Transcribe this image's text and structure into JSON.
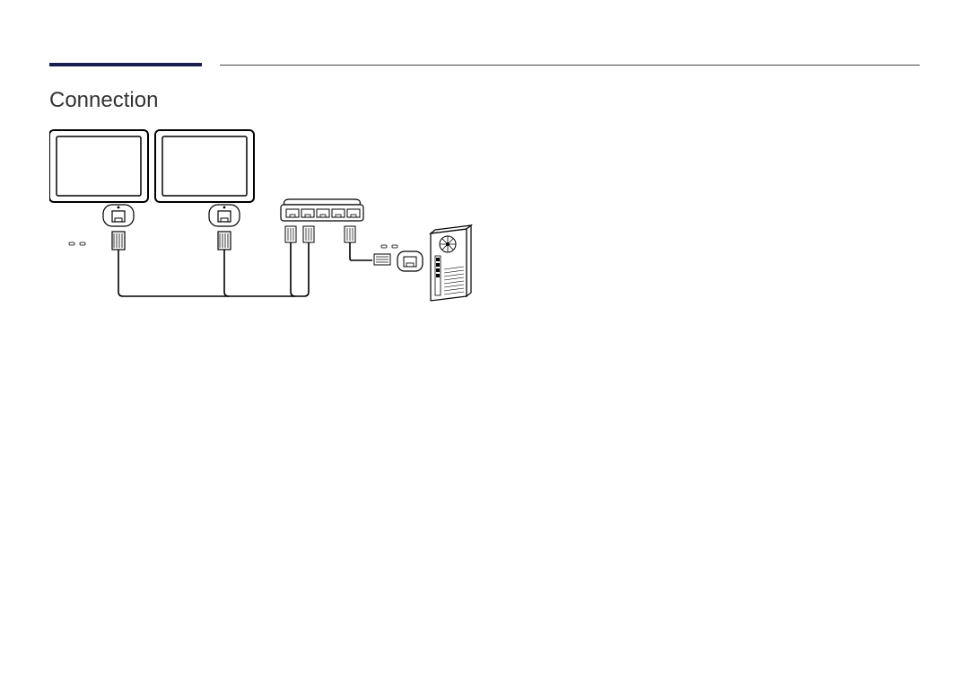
{
  "section": {
    "title": "Connection"
  },
  "colors": {
    "accent": "#1b1f4d"
  }
}
